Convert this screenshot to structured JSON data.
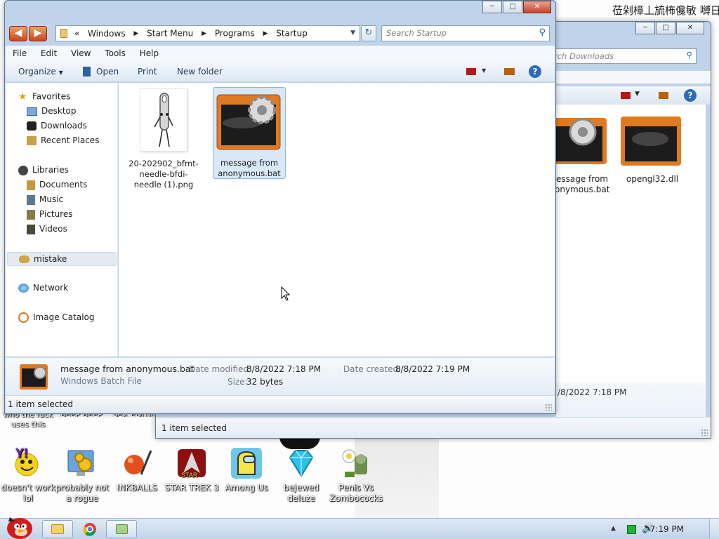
{
  "desktop": {
    "partial_labels": [
      "who the fuck uses this",
      "BEEP BEEP",
      "SEX EDITIO"
    ],
    "icons": [
      {
        "name": "yahoo-icon",
        "label": "doesn't work lol"
      },
      {
        "name": "gears-monitor-icon",
        "label": "probably not a rogue"
      },
      {
        "name": "inkball-icon",
        "label": "INKBALLS"
      },
      {
        "name": "star-trek-icon",
        "label": "STAR TREK 3"
      },
      {
        "name": "among-us-icon",
        "label": "Among Us"
      },
      {
        "name": "diamond-icon",
        "label": "bejewed deluze"
      },
      {
        "name": "pvz-icon",
        "label": "Penis Vs Zombococks"
      }
    ],
    "top_right_text": "莅剁樟丄旈柨儳敏 嚩日枸勶讀"
  },
  "back_window": {
    "search_placeholder": "rch Downloads",
    "files": [
      {
        "name": "essage from\nonymous.bat"
      },
      {
        "name": "opengl32.dll"
      }
    ],
    "details_date": "/8/2022 7:18 PM",
    "status": "1 item selected"
  },
  "front_window": {
    "caption_buttons": {
      "minimize": "─",
      "maximize": "□",
      "close": "✕"
    },
    "address_path": [
      "Windows",
      "Start Menu",
      "Programs",
      "Startup"
    ],
    "address_prefix": "«",
    "search_placeholder": "Search Startup",
    "menu": [
      "File",
      "Edit",
      "View",
      "Tools",
      "Help"
    ],
    "commands": {
      "organize": "Organize",
      "open": "Open",
      "print": "Print",
      "new_folder": "New folder"
    },
    "nav": {
      "favorites": "Favorites",
      "desktop": "Desktop",
      "downloads": "Downloads",
      "recent_places": "Recent Places",
      "libraries": "Libraries",
      "documents": "Documents",
      "music": "Music",
      "pictures": "Pictures",
      "videos": "Videos",
      "mistake": "mistake",
      "network": "Network",
      "image_catalog": "Image Catalog"
    },
    "files": [
      {
        "name": "20-202902_bfmt-needle-bfdi-needle (1).png"
      },
      {
        "name": "message from anonymous.bat",
        "selected": true
      }
    ],
    "details": {
      "filename": "message from anonymous.bat",
      "filetype": "Windows Batch File",
      "date_modified_label": "Date modified:",
      "date_modified": "8/8/2022 7:18 PM",
      "date_created_label": "Date created:",
      "date_created": "8/8/2022 7:19 PM",
      "size_label": "Size:",
      "size": "32 bytes"
    },
    "status": "1 item selected"
  },
  "taskbar": {
    "clock": "7:19 PM",
    "pinned": [
      "angry-birds-start-orb",
      "explorer-icon",
      "chrome-icon",
      "explorer-window-icon"
    ]
  },
  "colors": {
    "accent": "#3a6ea5",
    "selection": "#d8e8f8",
    "bat_orange": "#e07a20"
  }
}
